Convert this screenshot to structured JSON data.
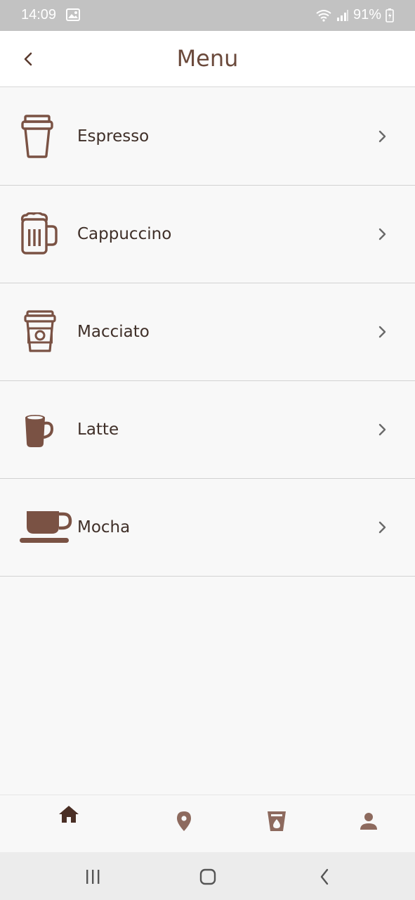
{
  "status_bar": {
    "time": "14:09",
    "battery": "91%"
  },
  "header": {
    "title": "Menu"
  },
  "menu": {
    "items": [
      {
        "label": "Espresso",
        "icon": "takeaway-cup-icon"
      },
      {
        "label": "Cappuccino",
        "icon": "beer-mug-icon"
      },
      {
        "label": "Macciato",
        "icon": "paper-cup-icon"
      },
      {
        "label": "Latte",
        "icon": "mug-icon"
      },
      {
        "label": "Mocha",
        "icon": "cup-saucer-icon"
      }
    ]
  },
  "bottom_nav": {
    "items": [
      {
        "icon": "home-icon",
        "active": true
      },
      {
        "icon": "location-pin-icon",
        "active": false
      },
      {
        "icon": "cup-icon",
        "active": false
      },
      {
        "icon": "person-icon",
        "active": false
      }
    ]
  },
  "colors": {
    "brand_brown": "#6b4a3c",
    "icon_brown": "#7a5244",
    "active_nav": "#4a2f25",
    "inactive_nav": "#8d6a5e"
  }
}
